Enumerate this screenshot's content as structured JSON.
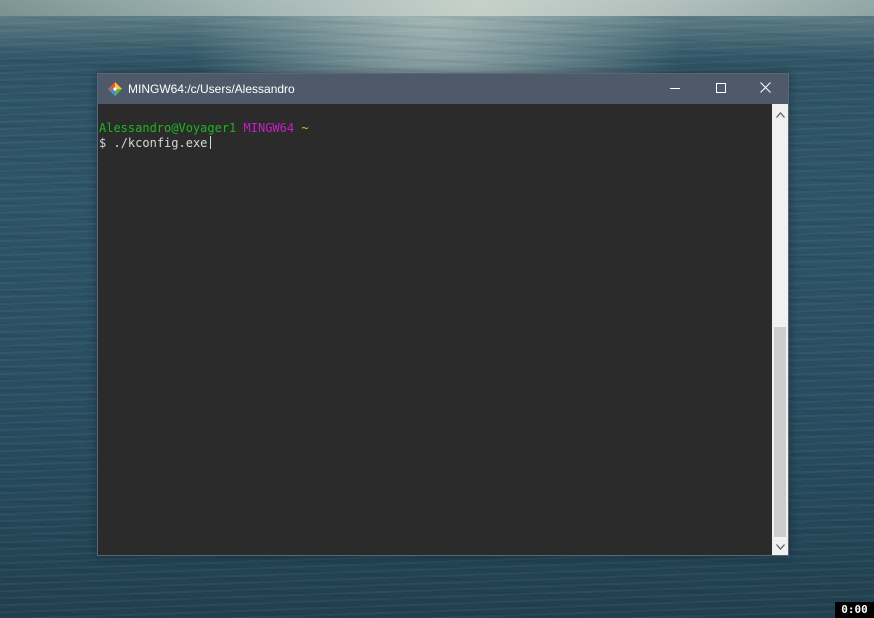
{
  "window": {
    "title": "MINGW64:/c/Users/Alessandro",
    "app_icon": "git-bash-icon",
    "controls": {
      "minimize_icon": "minimize-icon",
      "maximize_icon": "maximize-icon",
      "close_icon": "close-icon"
    }
  },
  "terminal": {
    "prompt": {
      "user_host": "Alessandro@Voyager1",
      "system": "MINGW64",
      "path": "~"
    },
    "command_line": {
      "symbol": "$",
      "command": "./kconfig.exe"
    },
    "colors": {
      "background": "#2b2b2b",
      "text": "#d7d7d7",
      "user_host": "#1fb41f",
      "system": "#c71fc7",
      "path": "#c8c81f"
    }
  },
  "scrollbar": {
    "up_icon": "chevron-up-icon",
    "down_icon": "chevron-down-icon"
  },
  "overlay": {
    "timer": "0:00"
  }
}
